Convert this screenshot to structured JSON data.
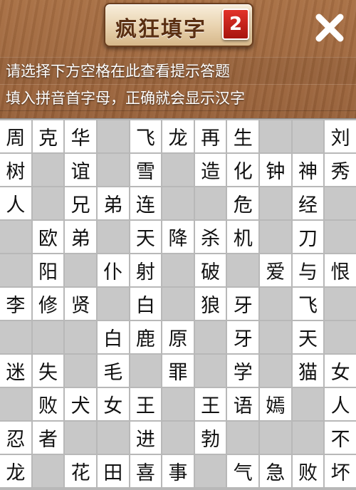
{
  "header": {
    "title": "疯狂填字",
    "level": "2",
    "close_icon": "close-icon"
  },
  "hints": {
    "line1": "请选择下方空格在此查看提示答题",
    "line2": "填入拼音首字母，正确就会显示汉字"
  },
  "grid": {
    "rows": [
      [
        "周",
        "克",
        "华",
        "",
        "飞",
        "龙",
        "再",
        "生",
        "",
        "",
        "刘"
      ],
      [
        "树",
        "",
        "谊",
        "",
        "雪",
        "",
        "造",
        "化",
        "钟",
        "神",
        "秀"
      ],
      [
        "人",
        "",
        "兄",
        "弟",
        "连",
        "",
        "",
        "危",
        "",
        "经",
        ""
      ],
      [
        "",
        "欧",
        "弟",
        "",
        "天",
        "降",
        "杀",
        "机",
        "",
        "刀",
        ""
      ],
      [
        "",
        "阳",
        "",
        "仆",
        "射",
        "",
        "破",
        "",
        "爱",
        "与",
        "恨"
      ],
      [
        "李",
        "修",
        "贤",
        "",
        "白",
        "",
        "狼",
        "牙",
        "",
        "飞",
        ""
      ],
      [
        "",
        "",
        "",
        "白",
        "鹿",
        "原",
        "",
        "牙",
        "",
        "天",
        ""
      ],
      [
        "迷",
        "失",
        "",
        "毛",
        "",
        "罪",
        "",
        "学",
        "",
        "猫",
        "女"
      ],
      [
        "",
        "败",
        "犬",
        "女",
        "王",
        "",
        "王",
        "语",
        "嫣",
        "",
        "人"
      ],
      [
        "忍",
        "者",
        "",
        "",
        "进",
        "",
        "勃",
        "",
        "",
        "",
        "不"
      ],
      [
        "龙",
        "",
        "花",
        "田",
        "喜",
        "事",
        "",
        "气",
        "急",
        "败",
        "坏"
      ]
    ]
  }
}
